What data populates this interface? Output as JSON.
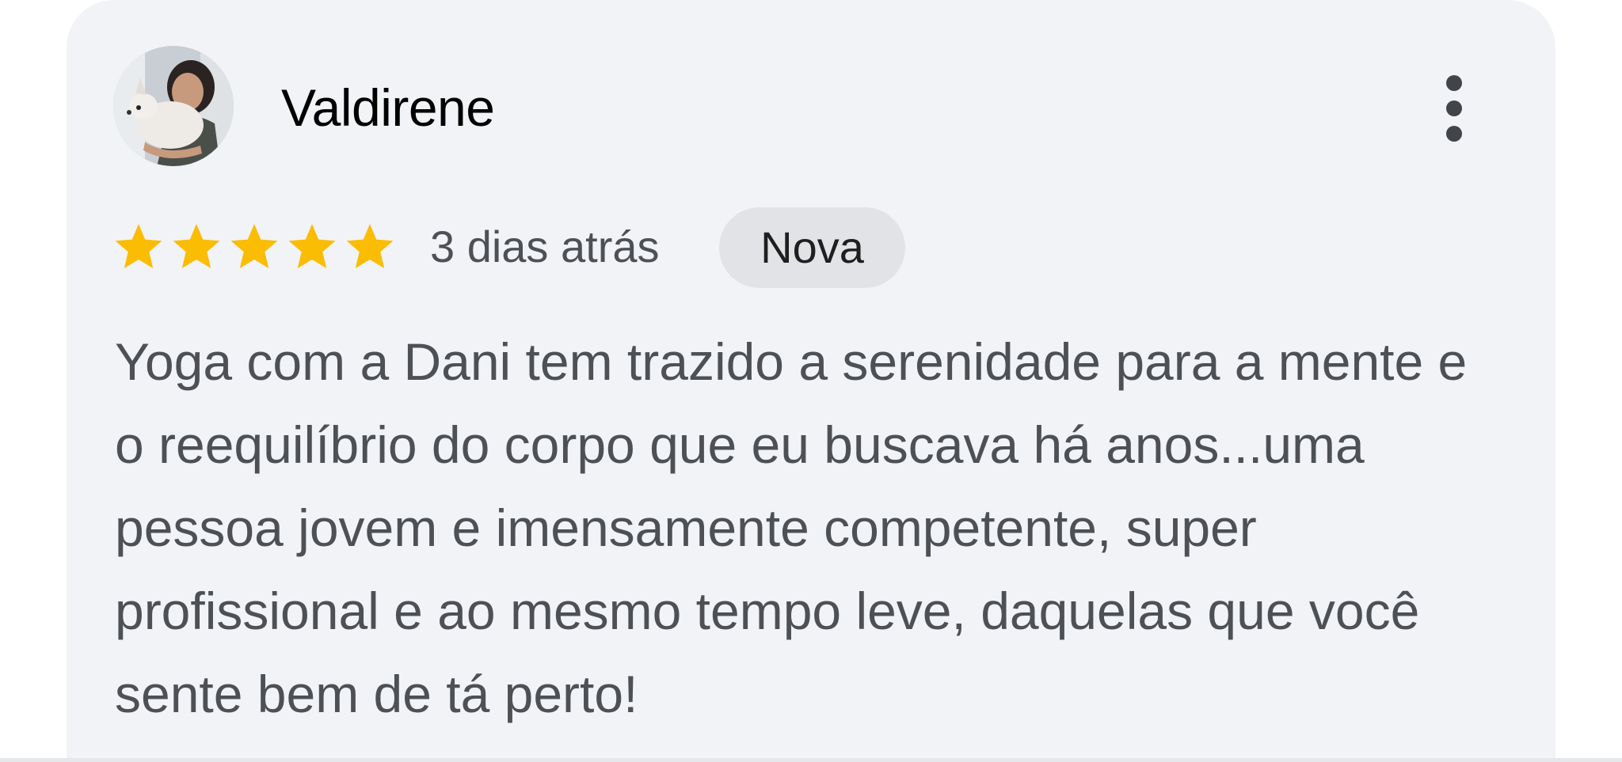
{
  "review": {
    "reviewer_name": "Valdirene",
    "avatar_icon": "reviewer-avatar-photo",
    "more_icon": "more-vert-icon",
    "rating": 5,
    "rating_max": 5,
    "star_color": "#fbbc04",
    "date": "3 dias atrás",
    "badge": "Nova",
    "text": "Yoga com a Dani tem trazido a serenidade para a mente e o reequilíbrio do corpo que eu buscava há anos...uma pessoa jovem e imensamente competente, super profissional e ao mesmo tempo leve, daquelas que você sente bem de tá perto!"
  }
}
